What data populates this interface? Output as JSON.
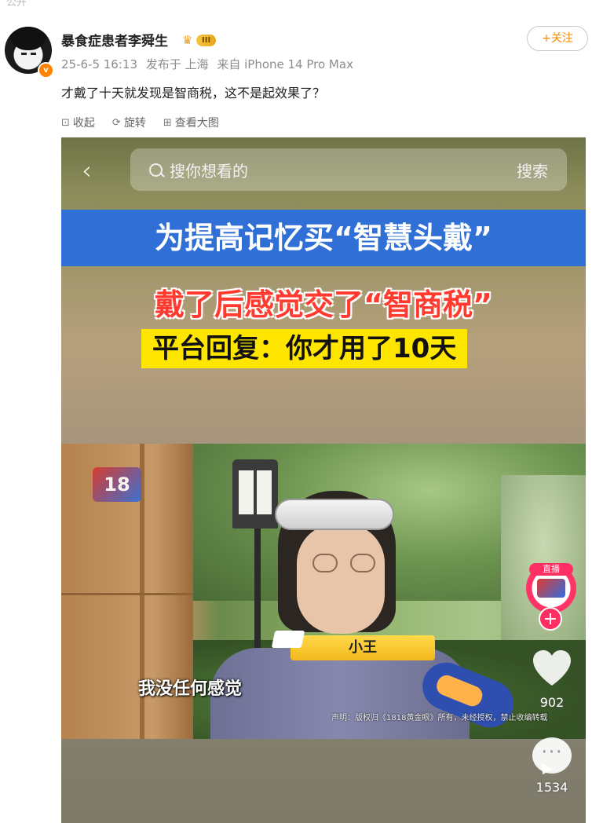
{
  "top_cut_text": "公开",
  "post": {
    "username": "暴食症患者李舜生",
    "level_badge": "III",
    "date": "25-6-5 16:13",
    "published_in": "发布于 上海",
    "device": "来自 iPhone 14 Pro Max",
    "follow_label": "+关注",
    "text": "才戴了十天就发现是智商税，这不是起效果了？",
    "actions": {
      "collapse": "收起",
      "rotate": "旋转",
      "view_large": "查看大图"
    }
  },
  "media": {
    "search_placeholder": "搜你想看的",
    "search_button": "搜索",
    "headline_blue": "为提高记忆买“智慧头戴”",
    "headline_red": "戴了后感觉交了“智商税”",
    "headline_yellow": "平台回复：你才用了10天",
    "tv_logo": "18",
    "name_tag": "小王",
    "subtitle": "我没任何感觉",
    "disclaimer": "声明：版权归《1818黄金眼》所有，未经授权，禁止收编转载",
    "live_label": "直播",
    "likes": "902",
    "comments": "1534"
  },
  "colors": {
    "accent_orange": "#f28a00",
    "banner_blue": "#2f6fd6",
    "headline_red": "#ff3b2f",
    "highlight_yellow": "#ffe600",
    "live_pink": "#ff2e63"
  }
}
